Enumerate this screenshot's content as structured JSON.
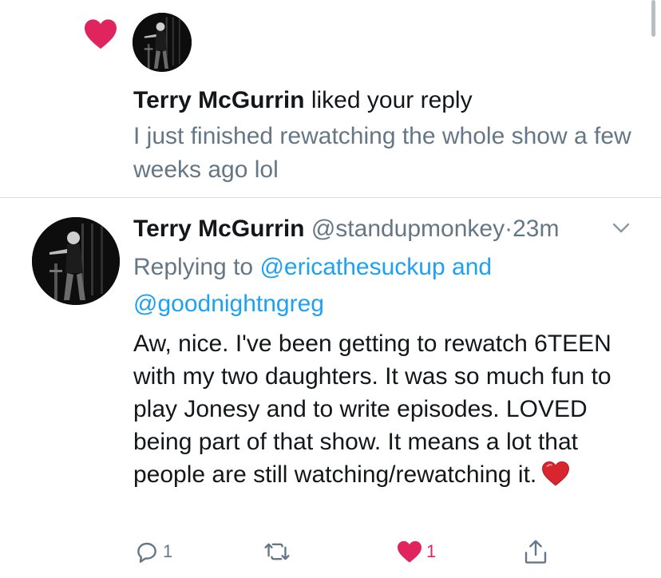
{
  "notification": {
    "liker_name": "Terry McGurrin",
    "action_text": "liked your reply",
    "quoted_reply": "I just finished rewatching the whole show a few weeks ago lol"
  },
  "reply": {
    "name": "Terry McGurrin",
    "handle": "@standupmonkey",
    "separator": "·",
    "time": "23m",
    "replying_prefix": "Replying to",
    "mention_1": "@ericathesuckup",
    "conjunction": "and",
    "mention_2": "@goodnightngreg",
    "text": "Aw, nice. I've been getting to rewatch 6TEEN with my two daughters. It was so much fun to play Jonesy and to write episodes. LOVED being part of that show. It means a lot that people are still watching/rewatching it.",
    "emoji": "red-heart-emoji"
  },
  "actions": {
    "reply_count": "1",
    "retweet_count": "",
    "like_count": "1",
    "liked": true
  },
  "colors": {
    "like": "#e0245e",
    "link": "#1da1f2",
    "secondary_text": "#657786",
    "primary_text": "#14171a"
  },
  "icons": [
    "heart-icon",
    "caret-down-icon",
    "reply-icon",
    "retweet-icon",
    "like-icon",
    "share-icon"
  ]
}
